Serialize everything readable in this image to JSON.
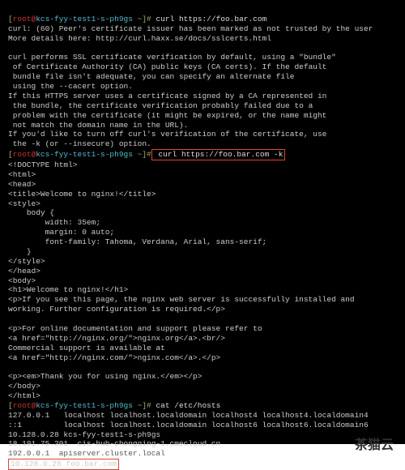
{
  "prompt1": {
    "open_b": "[",
    "user": "root@",
    "host": "kcs-fyy-test1-s-ph9gs",
    "tilde": " ~",
    "close_b": "]#",
    "cmd": " curl https://foo.bar.com"
  },
  "err1": "curl: (60) Peer's certificate issuer has been marked as not trusted by the user",
  "err2": "More details here: http://curl.haxx.se/docs/sslcerts.html",
  "blank": "",
  "info1": "curl performs SSL certificate verification by default, using a \"bundle\"",
  "info2": " of Certificate Authority (CA) public keys (CA certs). If the default",
  "info3": " bundle file isn't adequate, you can specify an alternate file",
  "info4": " using the --cacert option.",
  "info5": "If this HTTPS server uses a certificate signed by a CA represented in",
  "info6": " the bundle, the certificate verification probably failed due to a",
  "info7": " problem with the certificate (it might be expired, or the name might",
  "info8": " not match the domain name in the URL).",
  "info9": "If you'd like to turn off curl's verification of the certificate, use",
  "info10": " the -k (or --insecure) option.",
  "prompt2": {
    "open_b": "[",
    "user": "root@",
    "host": "kcs-fyy-test1-s-ph9gs",
    "tilde": " ~",
    "close_b": "]#",
    "cmd": " curl https://foo.bar.com -k"
  },
  "out1": "<!DOCTYPE html>",
  "out2": "<html>",
  "out3": "<head>",
  "out4": "<title>Welcome to nginx!</title>",
  "out5": "<style>",
  "out6": "    body {",
  "out7": "        width: 35em;",
  "out8": "        margin: 0 auto;",
  "out9": "        font-family: Tahoma, Verdana, Arial, sans-serif;",
  "out10": "    }",
  "out11": "</style>",
  "out12": "</head>",
  "out13": "<body>",
  "out14": "<h1>Welcome to nginx!</h1>",
  "out15": "<p>If you see this page, the nginx web server is successfully installed and",
  "out16": "working. Further configuration is required.</p>",
  "out17": "<p>For online documentation and support please refer to",
  "out18": "<a href=\"http://nginx.org/\">nginx.org</a>.<br/>",
  "out19": "Commercial support is available at",
  "out20": "<a href=\"http://nginx.com/\">nginx.com</a>.</p>",
  "out21": "<p><em>Thank you for using nginx.</em></p>",
  "out22": "</body>",
  "out23": "</html>",
  "prompt3": {
    "open_b": "[",
    "user": "root@",
    "host": "kcs-fyy-test1-s-ph9gs",
    "tilde": " ~",
    "close_b": "]#",
    "cmd": " cat /etc/hosts"
  },
  "hosts1": "127.0.0.1   localhost localhost.localdomain localhost4 localhost4.localdomain4",
  "hosts2": "::1         localhost localhost.localdomain localhost6 localhost6.localdomain6",
  "hosts3": "10.128.0.28 kcs-fyy-test1-s-ph9gs",
  "hosts4": "18.191.75.201  cis-hub-chongqing-1.cmecloud.cn",
  "hosts5_pre": "192.0.0.1  apiserver.cluster.local",
  "hosts5_box": "10.128.0.28 foo.bar.com",
  "watermark": "茶猫云"
}
